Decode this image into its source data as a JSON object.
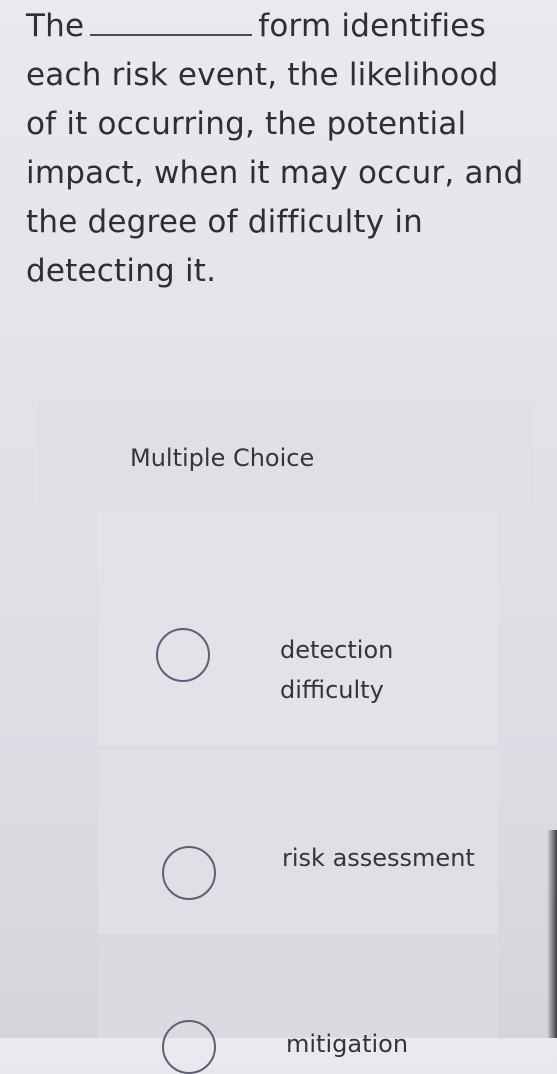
{
  "question": {
    "prefix": "The",
    "suffix": "form identifies each risk event, the likelihood of it occurring, the potential impact, when it may occur, and the degree of difficulty in detecting it."
  },
  "answer_panel": {
    "type_label": "Multiple Choice"
  },
  "options": [
    {
      "label": "detection difficulty",
      "selected": false
    },
    {
      "label": "risk assessment",
      "selected": false
    },
    {
      "label": "mitigation",
      "selected": false
    }
  ],
  "colors": {
    "background": "#e5e5ea",
    "panel": "#dfdfe5",
    "radio_border": "#5d6075",
    "text": "#2e2e35"
  }
}
